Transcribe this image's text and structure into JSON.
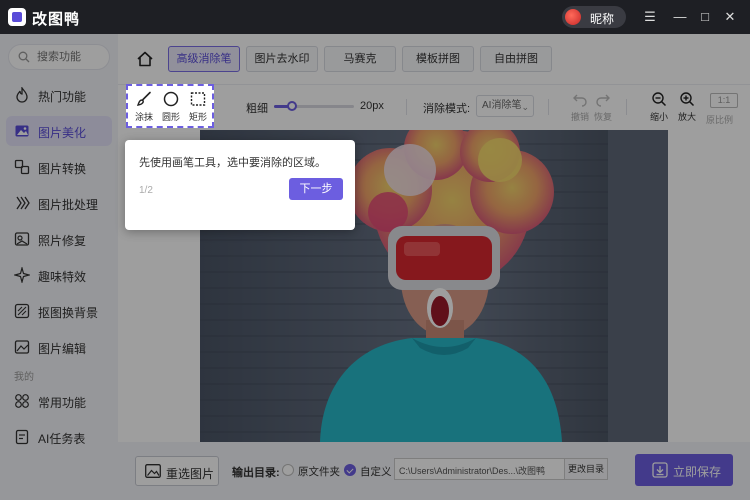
{
  "app": {
    "title": "改图鸭",
    "user_name": "昵称"
  },
  "window_controls": {
    "menu": "☰",
    "minimize": "—",
    "maximize": "□",
    "close": "✕"
  },
  "sidebar": {
    "search_placeholder": "搜索功能",
    "items": [
      {
        "label": "热门功能",
        "icon": "fire-icon"
      },
      {
        "label": "图片美化",
        "icon": "image-edit-icon",
        "active": true
      },
      {
        "label": "图片转换",
        "icon": "convert-icon"
      },
      {
        "label": "图片批处理",
        "icon": "batch-icon"
      },
      {
        "label": "照片修复",
        "icon": "photo-repair-icon"
      },
      {
        "label": "趣味特效",
        "icon": "sparkle-icon"
      },
      {
        "label": "抠图换背景",
        "icon": "cutout-icon"
      },
      {
        "label": "图片编辑",
        "icon": "picture-icon"
      }
    ],
    "section_label": "我的",
    "my_items": [
      {
        "label": "常用功能",
        "icon": "grid-icon"
      },
      {
        "label": "AI任务表",
        "icon": "task-list-icon"
      }
    ]
  },
  "tabs": [
    {
      "label": "高级消除笔",
      "active": true
    },
    {
      "label": "图片去水印"
    },
    {
      "label": "马赛克"
    },
    {
      "label": "模板拼图"
    },
    {
      "label": "自由拼图"
    }
  ],
  "toolbar": {
    "tools": [
      {
        "label": "涂抹",
        "icon": "brush-icon"
      },
      {
        "label": "圆形",
        "icon": "circle-icon"
      },
      {
        "label": "矩形",
        "icon": "rectangle-icon"
      }
    ],
    "thickness_label": "粗细",
    "thickness_value": "20px",
    "thickness_fraction": 0.22,
    "mode_label": "消除模式:",
    "mode_value": "AI消除笔",
    "undo": "撤销",
    "redo": "恢复",
    "zoom_out": "缩小",
    "zoom_in": "放大",
    "ratio_box": "1:1",
    "ratio_label": "原比例"
  },
  "tooltip": {
    "text": "先使用画笔工具，选中要消除的区域。",
    "step": "1/2",
    "next": "下一步"
  },
  "bottom": {
    "reselect": "重选图片",
    "output_label": "输出目录:",
    "option_original": "原文件夹",
    "option_custom": "自定义",
    "path": "C:\\Users\\Administrator\\Des...\\改图鸭",
    "change_dir": "更改目录",
    "save": "立即保存"
  },
  "colors": {
    "accent": "#6c5ee0",
    "titlebar": "#1e1f24"
  }
}
